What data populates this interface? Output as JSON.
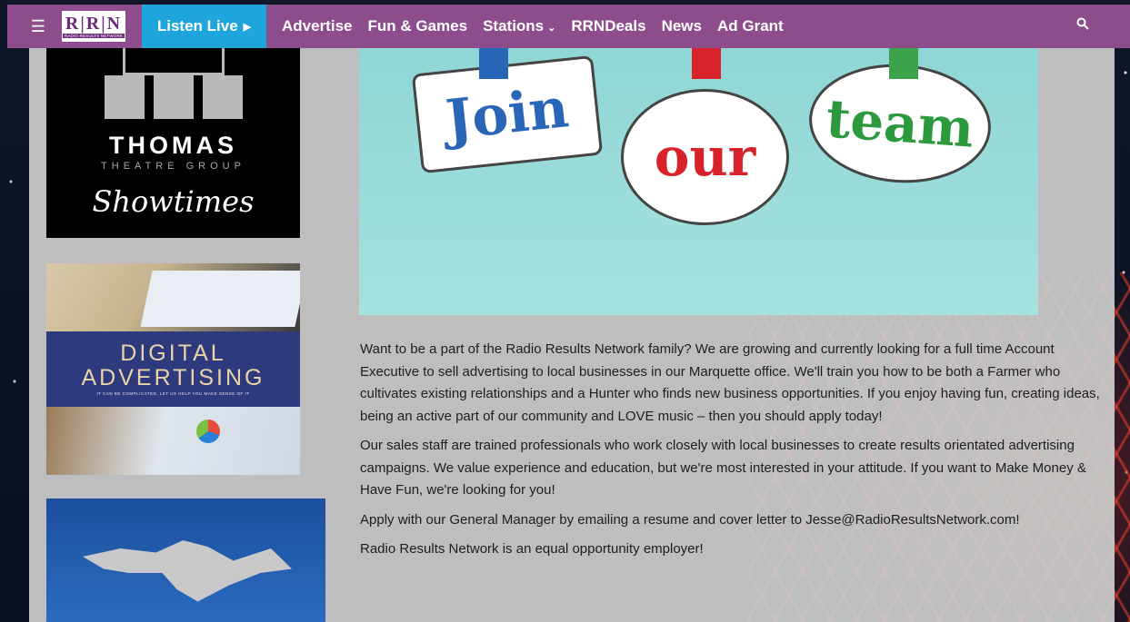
{
  "header": {
    "logo_letters": "R|R|N",
    "logo_sub": "RADIO RESULTS NETWORK",
    "listen_live": "Listen Live",
    "nav": [
      "Advertise",
      "Fun & Games",
      "Stations",
      "RRNDeals",
      "News",
      "Ad Grant"
    ]
  },
  "icons": {
    "menu": "hamburger-menu-icon",
    "play": "play-icon",
    "chevron": "chevron-down-icon",
    "search": "search-icon"
  },
  "sidebar": {
    "thomas": {
      "title": "THOMAS",
      "sub": "THEATRE GROUP",
      "script": "Showtimes"
    },
    "digital": {
      "title_line1": "DIGITAL",
      "title_line2": "ADVERTISING",
      "sub": "IT CAN BE COMPLICATED, LET US HELP YOU MAKE SENSE OF IT"
    }
  },
  "hero": {
    "word1": "Join",
    "word2": "our",
    "word3": "team"
  },
  "article": {
    "p1": "Want to be a part of the Radio Results Network family? We are growing and currently looking for a full time Account Executive to sell advertising to local businesses in our Marquette office. We'll train you how to be both a Farmer who cultivates existing relationships and a Hunter who finds new business opportunities. If you enjoy having fun, creating ideas, being an active part of our community and LOVE music – then you should apply today!",
    "p2": "Our sales staff are trained professionals who work closely with local businesses to create results orientated advertising campaigns. We value experience and education, but we're most interested in your attitude. If you want to Make Money & Have Fun, we're looking for you!",
    "p3": "Apply with our General Manager by emailing a resume and cover letter to Jesse@RadioResultsNetwork.com!",
    "p4": "Radio Results Network is an equal opportunity employer!"
  },
  "colors": {
    "header_bg": "#8d4d8d",
    "listen_live_bg": "#1ea6dc"
  }
}
